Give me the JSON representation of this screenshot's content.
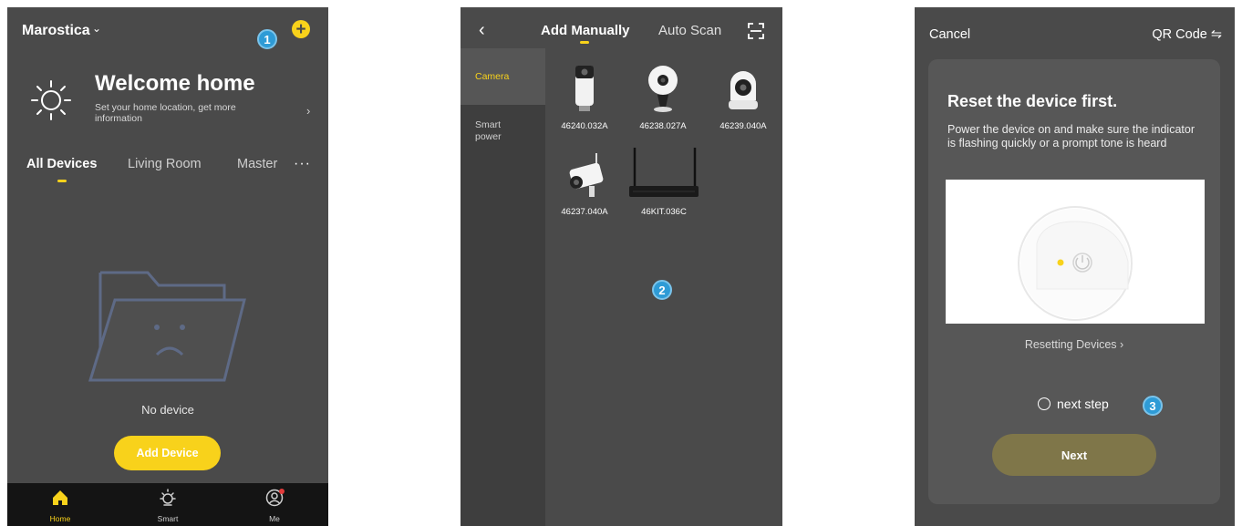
{
  "screen1": {
    "home_name": "Marostica",
    "chevron": "⌄",
    "plus": "+",
    "badge": "1",
    "welcome_title": "Welcome home",
    "welcome_subtitle": "Set your home location, get more information",
    "welcome_arrow": "›",
    "tabs": [
      "All Devices",
      "Living Room",
      "Master"
    ],
    "more": "···",
    "empty_text": "No device",
    "add_device_label": "Add Device",
    "nav": {
      "home": "Home",
      "smart": "Smart",
      "me": "Me"
    }
  },
  "screen2": {
    "back": "‹",
    "tab_active": "Add Manually",
    "tab_inactive": "Auto Scan",
    "categories": [
      "Camera",
      "Smart power"
    ],
    "devices": [
      "46240.032A",
      "46238.027A",
      "46239.040A",
      "46237.040A",
      "46KIT.036C"
    ],
    "badge": "2"
  },
  "screen3": {
    "cancel": "Cancel",
    "qr_code": "QR Code ⇋",
    "title": "Reset the device first.",
    "description": "Power the device on and make sure the indicator is flashing quickly or a prompt tone is heard",
    "resetting_link": "Resetting Devices ›",
    "next_step": "next step",
    "next_button": "Next",
    "badge": "3"
  },
  "colors": {
    "screen_bg": "#4a4a4a",
    "accent_yellow": "#f8d21b",
    "badge_blue": "#2e9bd6",
    "next_button_olive": "#7f7649",
    "bottom_nav": "#141414"
  }
}
